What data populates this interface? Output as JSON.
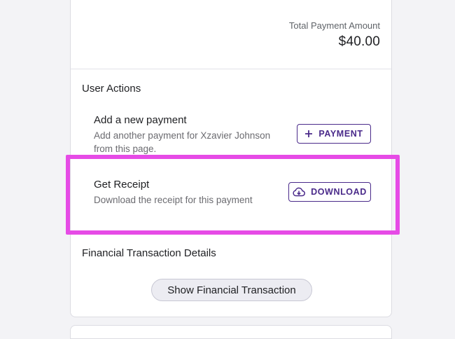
{
  "payment_summary": {
    "total_label": "Total Payment Amount",
    "total_value": "$40.00"
  },
  "user_actions": {
    "title": "User Actions",
    "add_payment": {
      "title": "Add a new payment",
      "description": "Add another payment for Xzavier Johnson from this page.",
      "button_label": "PAYMENT",
      "button_icon": "plus-icon"
    },
    "get_receipt": {
      "title": "Get Receipt",
      "description": "Download the receipt for this payment",
      "button_label": "DOWNLOAD",
      "button_icon": "cloud-download-icon"
    }
  },
  "financial_details": {
    "title": "Financial Transaction Details",
    "button_label": "Show Financial Transaction"
  },
  "colors": {
    "accent": "#4a2a8a",
    "highlight": "#e64be6",
    "background": "#f3f3f6"
  }
}
